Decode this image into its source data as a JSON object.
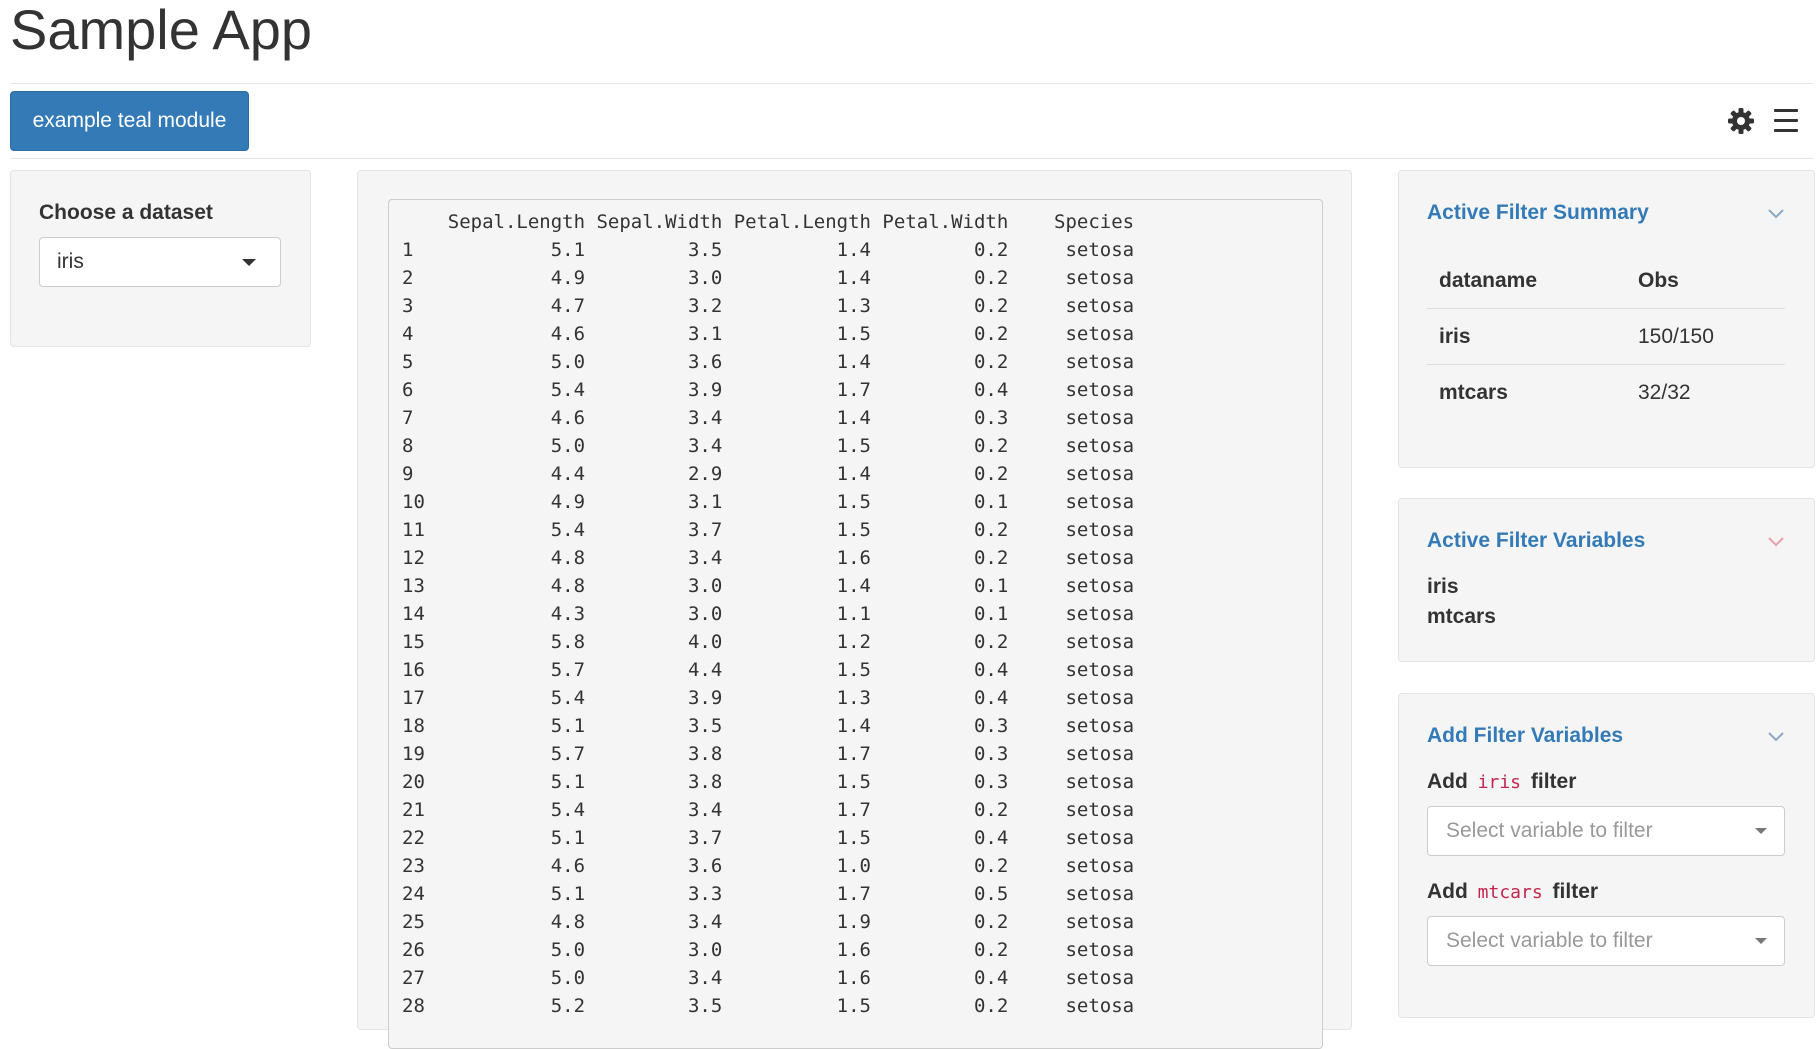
{
  "app": {
    "title": "Sample App"
  },
  "navbar": {
    "module_tab": "example teal module",
    "icons": {
      "settings": "gear-icon",
      "menu": "hamburger-menu-icon"
    }
  },
  "encoding": {
    "dataset_label": "Choose a dataset",
    "dataset_value": "iris"
  },
  "output": {
    "columns": [
      "",
      "Sepal.Length",
      "Sepal.Width",
      "Petal.Length",
      "Petal.Width",
      "Species"
    ],
    "rows": [
      [
        "1",
        "5.1",
        "3.5",
        "1.4",
        "0.2",
        "setosa"
      ],
      [
        "2",
        "4.9",
        "3.0",
        "1.4",
        "0.2",
        "setosa"
      ],
      [
        "3",
        "4.7",
        "3.2",
        "1.3",
        "0.2",
        "setosa"
      ],
      [
        "4",
        "4.6",
        "3.1",
        "1.5",
        "0.2",
        "setosa"
      ],
      [
        "5",
        "5.0",
        "3.6",
        "1.4",
        "0.2",
        "setosa"
      ],
      [
        "6",
        "5.4",
        "3.9",
        "1.7",
        "0.4",
        "setosa"
      ],
      [
        "7",
        "4.6",
        "3.4",
        "1.4",
        "0.3",
        "setosa"
      ],
      [
        "8",
        "5.0",
        "3.4",
        "1.5",
        "0.2",
        "setosa"
      ],
      [
        "9",
        "4.4",
        "2.9",
        "1.4",
        "0.2",
        "setosa"
      ],
      [
        "10",
        "4.9",
        "3.1",
        "1.5",
        "0.1",
        "setosa"
      ],
      [
        "11",
        "5.4",
        "3.7",
        "1.5",
        "0.2",
        "setosa"
      ],
      [
        "12",
        "4.8",
        "3.4",
        "1.6",
        "0.2",
        "setosa"
      ],
      [
        "13",
        "4.8",
        "3.0",
        "1.4",
        "0.1",
        "setosa"
      ],
      [
        "14",
        "4.3",
        "3.0",
        "1.1",
        "0.1",
        "setosa"
      ],
      [
        "15",
        "5.8",
        "4.0",
        "1.2",
        "0.2",
        "setosa"
      ],
      [
        "16",
        "5.7",
        "4.4",
        "1.5",
        "0.4",
        "setosa"
      ],
      [
        "17",
        "5.4",
        "3.9",
        "1.3",
        "0.4",
        "setosa"
      ],
      [
        "18",
        "5.1",
        "3.5",
        "1.4",
        "0.3",
        "setosa"
      ],
      [
        "19",
        "5.7",
        "3.8",
        "1.7",
        "0.3",
        "setosa"
      ],
      [
        "20",
        "5.1",
        "3.8",
        "1.5",
        "0.3",
        "setosa"
      ],
      [
        "21",
        "5.4",
        "3.4",
        "1.7",
        "0.2",
        "setosa"
      ],
      [
        "22",
        "5.1",
        "3.7",
        "1.5",
        "0.4",
        "setosa"
      ],
      [
        "23",
        "4.6",
        "3.6",
        "1.0",
        "0.2",
        "setosa"
      ],
      [
        "24",
        "5.1",
        "3.3",
        "1.7",
        "0.5",
        "setosa"
      ],
      [
        "25",
        "4.8",
        "3.4",
        "1.9",
        "0.2",
        "setosa"
      ],
      [
        "26",
        "5.0",
        "3.0",
        "1.6",
        "0.2",
        "setosa"
      ],
      [
        "27",
        "5.0",
        "3.4",
        "1.6",
        "0.4",
        "setosa"
      ],
      [
        "28",
        "5.2",
        "3.5",
        "1.5",
        "0.2",
        "setosa"
      ]
    ]
  },
  "filters": {
    "summary": {
      "title": "Active Filter Summary",
      "headers": [
        "dataname",
        "Obs"
      ],
      "rows": [
        {
          "name": "iris",
          "obs": "150/150"
        },
        {
          "name": "mtcars",
          "obs": "32/32"
        }
      ]
    },
    "active_vars": {
      "title": "Active Filter Variables",
      "items": [
        "iris",
        "mtcars"
      ]
    },
    "add_vars": {
      "title": "Add Filter Variables",
      "add_word": "Add",
      "filter_word": "filter",
      "datasets": [
        {
          "name": "iris",
          "placeholder": "Select variable to filter"
        },
        {
          "name": "mtcars",
          "placeholder": "Select variable to filter"
        }
      ]
    }
  },
  "colors": {
    "primary": "#337ab7",
    "code": "#c7254e",
    "panel_bg": "#f5f5f5"
  }
}
